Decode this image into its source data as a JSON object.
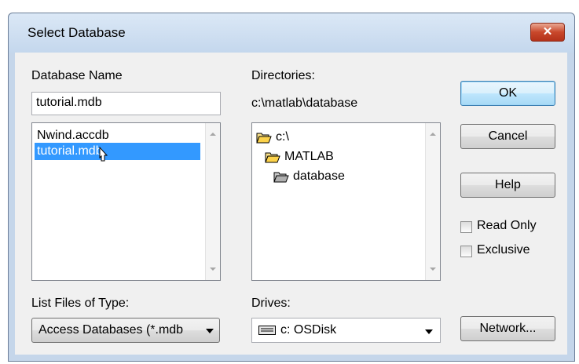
{
  "window": {
    "title": "Select Database",
    "close_glyph": "✕"
  },
  "database_name": {
    "label": "Database Name",
    "value": "tutorial.mdb",
    "files": [
      {
        "name": "Nwind.accdb",
        "selected": false
      },
      {
        "name": "tutorial.mdb",
        "selected": true
      }
    ]
  },
  "directories": {
    "label": "Directories:",
    "current_path": "c:\\matlab\\database",
    "tree": [
      {
        "name": "c:\\",
        "icon": "open-folder-icon"
      },
      {
        "name": "MATLAB",
        "icon": "open-folder-icon"
      },
      {
        "name": "database",
        "icon": "open-folder-icon"
      }
    ]
  },
  "file_type": {
    "label": "List Files of Type:",
    "value": "Access Databases (*.mdb"
  },
  "drives": {
    "label": "Drives:",
    "value": "c: OSDisk",
    "icon": "drive-icon"
  },
  "buttons": {
    "ok": "OK",
    "cancel": "Cancel",
    "help": "Help",
    "network": "Network..."
  },
  "options": {
    "read_only": {
      "label": "Read Only",
      "checked": false
    },
    "exclusive": {
      "label": "Exclusive",
      "checked": false
    }
  },
  "colors": {
    "selection": "#3399ff",
    "title_bg": "#c5d6ea",
    "close_button": "#c9482b"
  }
}
